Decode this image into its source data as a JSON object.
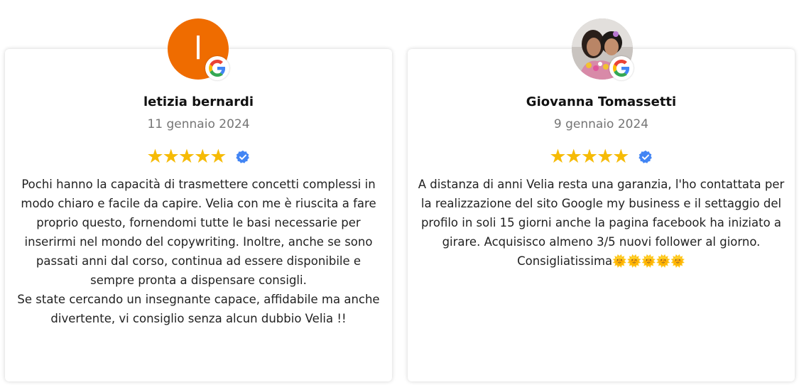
{
  "reviews": [
    {
      "avatar_letter": "l",
      "avatar_color": "#ef6c00",
      "name": "letizia bernardi",
      "date": "11 gennaio 2024",
      "rating": 5,
      "text_p1": "Pochi hanno la capacità di trasmettere concetti complessi in modo chiaro e facile da capire. Velia con me è riuscita a fare proprio questo, fornendomi tutte le basi necessarie per inserirmi nel mondo del copywriting. Inoltre, anche se sono passati anni dal corso, continua ad essere disponibile e sempre pronta a dispensare consigli.",
      "text_p2": "Se state cercando un insegnante capace, affidabile ma anche divertente, vi consiglio senza alcun dubbio Velia !!"
    },
    {
      "name": "Giovanna Tomassetti",
      "date": "9 gennaio 2024",
      "rating": 5,
      "text": "A distanza di anni Velia resta una garanzia, l'ho contattata per la realizzazione del sito Google my business e il settaggio del profilo in soli 15 giorni anche la pagina facebook ha iniziato a girare. Acquisisco almeno 3/5 nuovi follower al giorno. Consigliatissima",
      "emoji": "🌞🌞🌞🌞🌞"
    }
  ],
  "icons": {
    "star": "★",
    "google": "google-icon",
    "verified": "verified-badge-icon"
  },
  "colors": {
    "star": "#f6bb06",
    "verified": "#4285f4",
    "date": "#757575"
  }
}
